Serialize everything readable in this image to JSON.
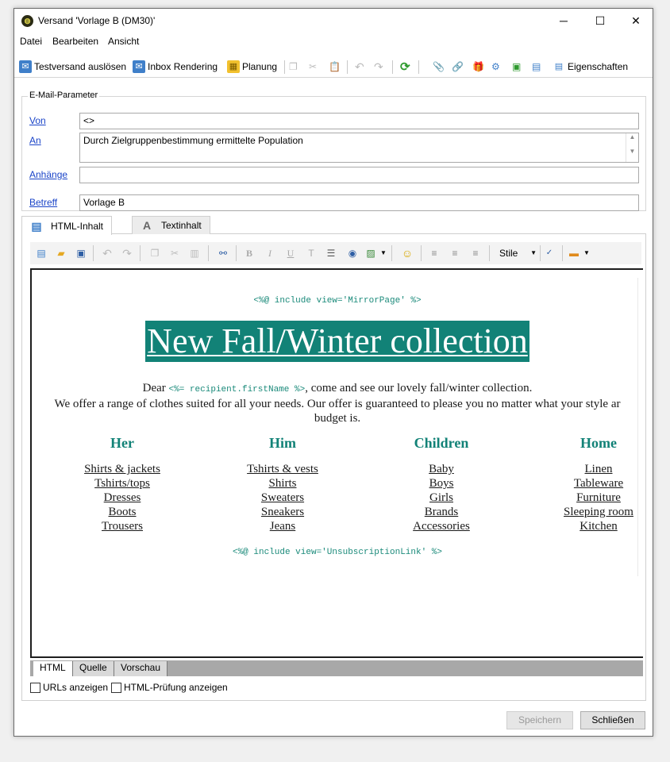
{
  "window": {
    "title": "Versand 'Vorlage B (DM30)'",
    "controls": {
      "minimize": "─",
      "maximize": "☐",
      "close": "✕"
    }
  },
  "menu": [
    "Datei",
    "Bearbeiten",
    "Ansicht"
  ],
  "toolbar": {
    "test_send": "Testversand auslösen",
    "inbox_rendering": "Inbox Rendering",
    "planning": "Planung",
    "properties": "Eigenschaften"
  },
  "email_params": {
    "group_title": "E-Mail-Parameter",
    "from_label": "Von",
    "from_value": "<>",
    "to_label": "An",
    "to_value": "Durch Zielgruppenbestimmung ermittelte Population",
    "attachments_label": "Anhänge",
    "attachments_value": "",
    "subject_label": "Betreff",
    "subject_value": "Vorlage B"
  },
  "tabs": {
    "html": "HTML-Inhalt",
    "text": "Textinhalt"
  },
  "editor_toolbar": {
    "styles_label": "Stile"
  },
  "content": {
    "mirror_include": "<%@ include view='MirrorPage' %>",
    "headline": "New Fall/Winter collection",
    "intro_dear": "Dear ",
    "intro_code": "<%= recipient.firstName %>",
    "intro_rest": ", come and see our lovely fall/winter collection.",
    "intro_line2": "We offer a range of clothes suited for all your needs. Our offer is guaranteed to please you no matter what your style ar",
    "intro_line3": "budget is.",
    "columns": [
      {
        "title": "Her",
        "links": [
          "Shirts & jackets",
          "Tshirts/tops",
          "Dresses",
          "Boots",
          "Trousers"
        ]
      },
      {
        "title": "Him",
        "links": [
          "Tshirts & vests",
          "Shirts",
          "Sweaters",
          "Sneakers",
          "Jeans"
        ]
      },
      {
        "title": "Children",
        "links": [
          "Baby",
          "Boys",
          "Girls",
          "Brands",
          "Accessories"
        ]
      },
      {
        "title": "Home",
        "links": [
          "Linen",
          "Tableware",
          "Furniture",
          "Sleeping room",
          "Kitchen"
        ]
      }
    ],
    "unsub_include": "<%@ include view='UnsubscriptionLink' %>"
  },
  "view_tabs": [
    "HTML",
    "Quelle",
    "Vorschau"
  ],
  "options": {
    "show_urls": "URLs anzeigen",
    "show_html_check": "HTML-Prüfung anzeigen"
  },
  "buttons": {
    "save": "Speichern",
    "close": "Schließen"
  },
  "colors": {
    "accent": "#128277",
    "link": "#1a44c8"
  }
}
